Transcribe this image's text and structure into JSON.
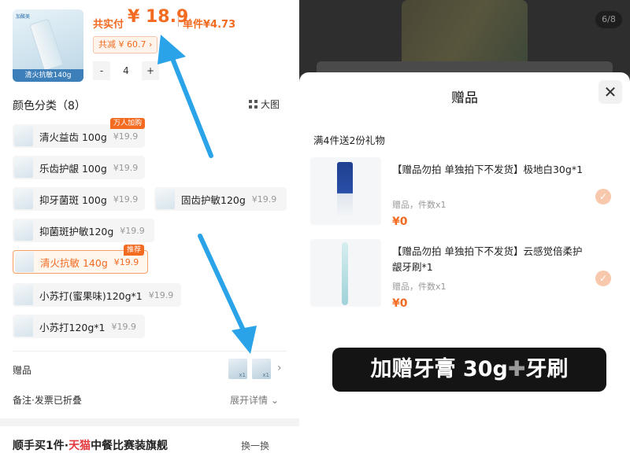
{
  "product": {
    "thumb_brand": "加酸美",
    "thumb_caption": "清火抗敏140g",
    "total_label": "共实付",
    "total_price": "¥ 18.9",
    "unit_label": "单件¥4.73",
    "discount": "共减 ¥ 60.7 ›",
    "qty_minus": "-",
    "qty": "4",
    "qty_plus": "+"
  },
  "variants": {
    "title": "颜色分类（8）",
    "bigview": "大图",
    "items": [
      {
        "name": "清火益齿 100g",
        "price": "¥19.9",
        "tag": "万人加购",
        "selected": false
      },
      {
        "name": "乐齿护龈 100g",
        "price": "¥19.9",
        "tag": "",
        "selected": false
      },
      {
        "name": "抑牙菌斑 100g",
        "price": "¥19.9",
        "tag": "",
        "selected": false
      },
      {
        "name": "固齿护敏120g",
        "price": "¥19.9",
        "tag": "",
        "selected": false
      },
      {
        "name": "抑菌斑护敏120g",
        "price": "¥19.9",
        "tag": "",
        "selected": false
      },
      {
        "name": "清火抗敏 140g",
        "price": "¥19.9",
        "tag": "推荐",
        "selected": true
      },
      {
        "name": "小苏打(蜜果味)120g*1",
        "price": "¥19.9",
        "tag": "",
        "selected": false
      },
      {
        "name": "小苏打120g*1",
        "price": "¥19.9",
        "tag": "",
        "selected": false
      }
    ]
  },
  "gifts_row": {
    "label": "赠品",
    "mini_count": "x1"
  },
  "notes_row": {
    "label": "备注·发票已折叠",
    "expand": "展开详情"
  },
  "bottom": {
    "prefix": "顺手买1件·",
    "red": "天猫",
    "suffix": "中餐比赛装旗舰",
    "swap": "换一换"
  },
  "gift_sheet": {
    "pager": "6/8",
    "title": "赠品",
    "close": "✕",
    "promo": "满4件送2份礼物",
    "items": [
      {
        "name": "【赠品勿拍 单独拍下不发货】极地白30g*1",
        "meta": "赠品，件数x1",
        "price": "¥0"
      },
      {
        "name": "【赠品勿拍 单独拍下不发货】云感觉倍柔护龈牙刷*1",
        "meta": "赠品，件数x1",
        "price": "¥0"
      }
    ]
  },
  "caption": {
    "text1": "加赠牙膏 30g",
    "plus": "✚",
    "text2": "牙刷"
  },
  "colors": {
    "accent": "#f26b21",
    "arrow": "#2aa3e8"
  }
}
